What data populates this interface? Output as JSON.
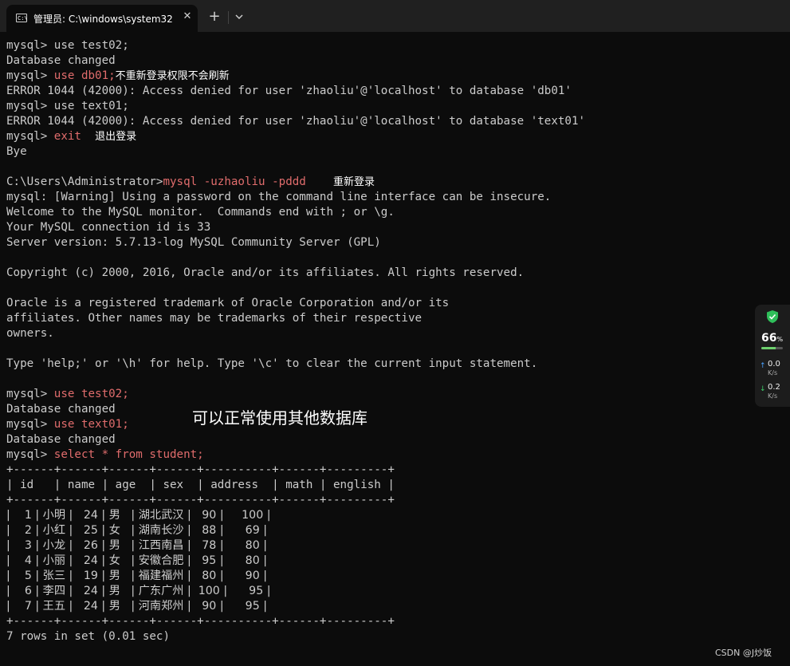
{
  "window": {
    "tab_title": "管理员: C:\\windows\\system32",
    "tab_icon": "terminal-icon",
    "close_glyph": "✕",
    "new_tab_glyph": "+"
  },
  "terminal": {
    "l1": "mysql> use test02;",
    "l2": "Database changed",
    "l3_prompt": "mysql> ",
    "l3_cmd": "use db01;",
    "l3_note": "不重新登录权限不会刷新",
    "l4": "ERROR 1044 (42000): Access denied for user 'zhaoliu'@'localhost' to database 'db01'",
    "l5": "mysql> use text01;",
    "l6": "ERROR 1044 (42000): Access denied for user 'zhaoliu'@'localhost' to database 'text01'",
    "l7_prompt": "mysql> ",
    "l7_cmd": "exit",
    "l7_note": "退出登录",
    "l8": "Bye",
    "l10_prompt": "C:\\Users\\Administrator>",
    "l10_cmd": "mysql -uzhaoliu -pddd",
    "l10_note": "重新登录",
    "l11": "mysql: [Warning] Using a password on the command line interface can be insecure.",
    "l12": "Welcome to the MySQL monitor.  Commands end with ; or \\g.",
    "l13": "Your MySQL connection id is 33",
    "l14": "Server version: 5.7.13-log MySQL Community Server (GPL)",
    "l16": "Copyright (c) 2000, 2016, Oracle and/or its affiliates. All rights reserved.",
    "l18": "Oracle is a registered trademark of Oracle Corporation and/or its",
    "l19": "affiliates. Other names may be trademarks of their respective",
    "l20": "owners.",
    "l22": "Type 'help;' or '\\h' for help. Type '\\c' to clear the current input statement.",
    "l24_prompt": "mysql> ",
    "l24_cmd": "use test02;",
    "l25": "Database changed",
    "l26_prompt": "mysql> ",
    "l26_cmd": "use text01;",
    "l27": "Database changed",
    "l28_prompt": "mysql> ",
    "l28_cmd": "select * from student;",
    "result": "7 rows in set (0.01 sec)"
  },
  "table": {
    "border": "+------+------+------+------+----------+------+---------+",
    "header": "| id   | name | age  | sex  | address  | math | english |",
    "rows": [
      "|    1 | 小明 |   24 | 男   | 湖北武汉 |   90 |     100 |",
      "|    2 | 小红 |   25 | 女   | 湖南长沙 |   88 |      69 |",
      "|    3 | 小龙 |   26 | 男   | 江西南昌 |   78 |      80 |",
      "|    4 | 小丽 |   24 | 女   | 安徽合肥 |   95 |      80 |",
      "|    5 | 张三 |   19 | 男   | 福建福州 |   80 |      90 |",
      "|    6 | 李四 |   24 | 男   | 广东广州 |  100 |      95 |",
      "|    7 | 王五 |   24 | 男   | 河南郑州 |   90 |      95 |"
    ]
  },
  "annotation": "可以正常使用其他数据库",
  "widget": {
    "percent": "66",
    "percent_unit": "%",
    "percent_value": 0.66,
    "up_value": "0.0",
    "up_unit": "K/s",
    "down_value": "0.2",
    "down_unit": "K/s"
  },
  "watermark": "CSDN @J炒饭",
  "colors": {
    "background": "#0c0c0c",
    "text": "#cccccc",
    "highlight": "#e06c6c",
    "shield": "#2fbf5a"
  }
}
